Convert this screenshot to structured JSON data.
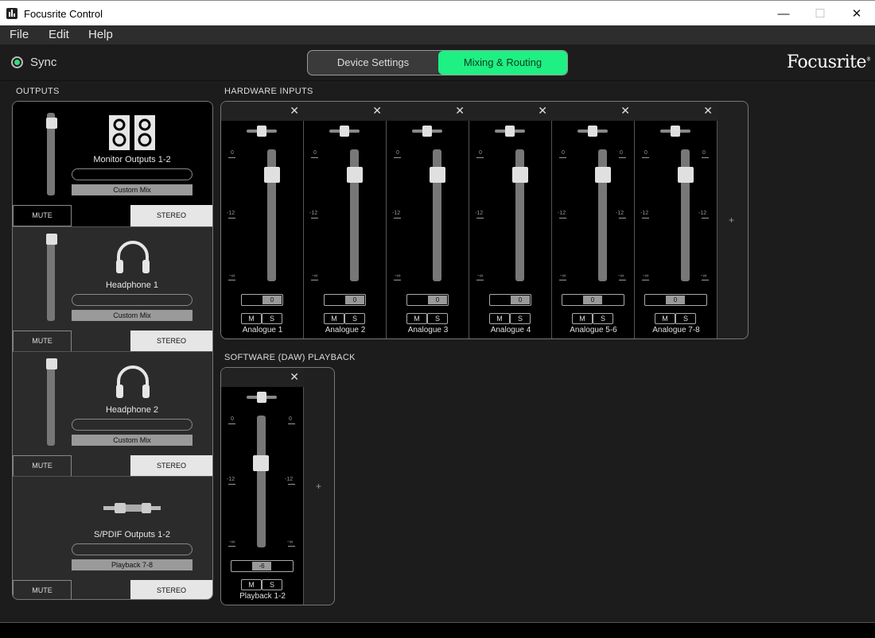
{
  "window": {
    "title": "Focusrite Control",
    "minimize": "—",
    "maximize": "☐",
    "close": "✕"
  },
  "menu": {
    "file": "File",
    "edit": "Edit",
    "help": "Help"
  },
  "sync": {
    "label": "Sync"
  },
  "tabs": {
    "device": "Device Settings",
    "mixing": "Mixing & Routing"
  },
  "brand": {
    "logo": "Focusrite",
    "logo_mark": "®",
    "accent": "#1ff083"
  },
  "sections": {
    "outputs": "OUTPUTS",
    "hardware_inputs": "HARDWARE INPUTS",
    "daw_playback": "SOFTWARE (DAW) PLAYBACK"
  },
  "outputs": [
    {
      "name": "Monitor Outputs 1-2",
      "mix": "Custom Mix",
      "mute": "MUTE",
      "stereo": "STEREO",
      "icon": "speakers-icon"
    },
    {
      "name": "Headphone 1",
      "mix": "Custom Mix",
      "mute": "MUTE",
      "stereo": "STEREO",
      "icon": "headphones-icon"
    },
    {
      "name": "Headphone 2",
      "mix": "Custom Mix",
      "mute": "MUTE",
      "stereo": "STEREO",
      "icon": "headphones-icon"
    },
    {
      "name": "S/PDIF Outputs 1-2",
      "mix": "Playback 7-8",
      "mute": "MUTE",
      "stereo": "STEREO",
      "icon": "rca-cable-icon"
    }
  ],
  "scale": {
    "top": "0",
    "mid": "-12",
    "bottom": "-∞"
  },
  "hardware_inputs": [
    {
      "name": "Analogue 1",
      "gain": "0",
      "m": "M",
      "s": "S",
      "close": "✕"
    },
    {
      "name": "Analogue 2",
      "gain": "0",
      "m": "M",
      "s": "S",
      "close": "✕"
    },
    {
      "name": "Analogue 3",
      "gain": "0",
      "m": "M",
      "s": "S",
      "close": "✕"
    },
    {
      "name": "Analogue 4",
      "gain": "0",
      "m": "M",
      "s": "S",
      "close": "✕"
    },
    {
      "name": "Analogue 5-6",
      "gain": "0",
      "m": "M",
      "s": "S",
      "close": "✕"
    },
    {
      "name": "Analogue 7-8",
      "gain": "0",
      "m": "M",
      "s": "S",
      "close": "✕"
    }
  ],
  "daw_playback": [
    {
      "name": "Playback 1-2",
      "gain": "-6",
      "m": "M",
      "s": "S",
      "close": "✕"
    }
  ],
  "add_label": "+"
}
